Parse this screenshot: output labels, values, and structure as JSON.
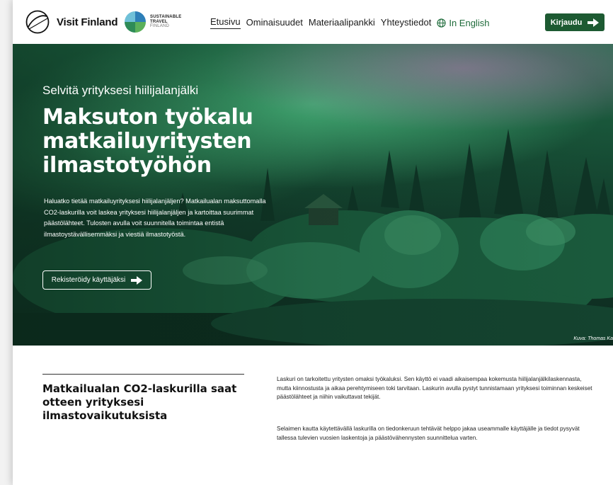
{
  "header": {
    "brand": "Visit Finland",
    "sustainable_logo": [
      "SUSTAINABLE",
      "TRAVEL",
      "FINLAND"
    ],
    "nav": [
      {
        "label": "Etusivu",
        "active": true
      },
      {
        "label": "Ominaisuudet"
      },
      {
        "label": "Materiaalipankki"
      },
      {
        "label": "Yhteystiedot"
      }
    ],
    "language": "In English",
    "login": "Kirjaudu"
  },
  "hero": {
    "eyebrow": "Selvitä yrityksesi hiilijalanjälki",
    "title": "Maksuton työkalu matkailuyritysten ilmastotyöhön",
    "text": "Haluatko tietää matkailuyrityksesi hiilijalanjäljen? Matkailualan maksuttomalla CO2-laskurilla voit laskea yrityksesi hiilijalanjäljen ja kartoittaa suurimmat päästölähteet. Tulosten avulla voit suunnitella toimintaa entistä ilmastoystävällisemmäksi ja viestiä ilmastotyöstä.",
    "cta": "Rekisteröidy käyttäjäksi",
    "photo_credit": "Kuva: Thomas Ka"
  },
  "info": {
    "heading": "Matkailualan CO2-laskurilla saat otteen yrityksesi ilmastovaikutuksista",
    "paragraphs": [
      "Laskuri on tarkoitettu yritysten omaksi työkaluksi. Sen käyttö ei vaadi aikaisempaa kokemusta hiilijalanjälkilaskennasta, mutta kiinnostusta ja aikaa perehtymiseen toki tarvitaan. Laskurin avulla pystyt tunnistamaan yrityksesi toiminnan keskeiset päästölähteet ja niihin vaikuttavat tekijät.",
      "Selaimen kautta käytettävällä laskurilla on tiedonkeruun tehtävät helppo jakaa useammalle käyttäjälle ja tiedot pysyvät tallessa tulevien vuosien laskentoja ja päästövähennysten suunnittelua varten."
    ]
  },
  "colors": {
    "brand_green": "#1d5a32",
    "link_green": "#1e6b3a"
  },
  "icons": [
    "visit-finland-logo-icon",
    "sustainable-travel-globe-icon",
    "globe-icon",
    "arrow-right-icon"
  ]
}
